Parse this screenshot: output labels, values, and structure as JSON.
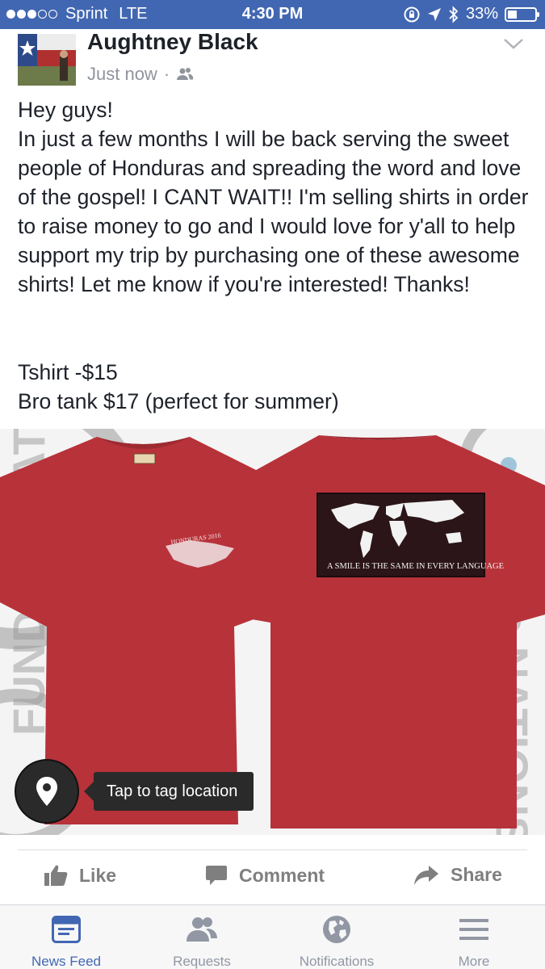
{
  "status_bar": {
    "carrier": "Sprint",
    "network": "LTE",
    "time": "4:30 PM",
    "battery": "33%",
    "battery_level": 0.33
  },
  "post": {
    "author": "Aughtney Black",
    "time": "Just now",
    "separator": "·",
    "privacy_icon": "friends-icon",
    "text": "Hey guys!\nIn just a few months I will be back serving the sweet people of Honduras and spreading the word and love of the gospel! I CANT WAIT!! I'm selling shirts in order to raise money to go and I would love for y'all to help support my trip by purchasing one of these awesome shirts! Let me know if you're interested! Thanks!",
    "prices": [
      "Tshirt -$15",
      "Bro tank $17 (perfect for summer)"
    ]
  },
  "photo": {
    "shirt_color": "#b8323a",
    "front_label": "HONDURAS 2016",
    "back_print": "A SMILE IS THE SAME IN EVERY LANGUAGE",
    "bg_logo_left": "FUND the NATIONS",
    "bg_logo_right": "the NATIONS"
  },
  "tag_location": "Tap to tag location",
  "actions": {
    "like": "Like",
    "comment": "Comment",
    "share": "Share"
  },
  "tabbar": {
    "tabs": [
      {
        "label": "News Feed",
        "icon": "news-feed-icon",
        "active": true
      },
      {
        "label": "Requests",
        "icon": "friend-requests-icon",
        "active": false
      },
      {
        "label": "Notifications",
        "icon": "globe-icon",
        "active": false
      },
      {
        "label": "More",
        "icon": "menu-icon",
        "active": false
      }
    ]
  },
  "colors": {
    "brand": "#4267b2",
    "text": "#1d2129",
    "muted": "#90949c",
    "action_gray": "#7f7f7f"
  }
}
